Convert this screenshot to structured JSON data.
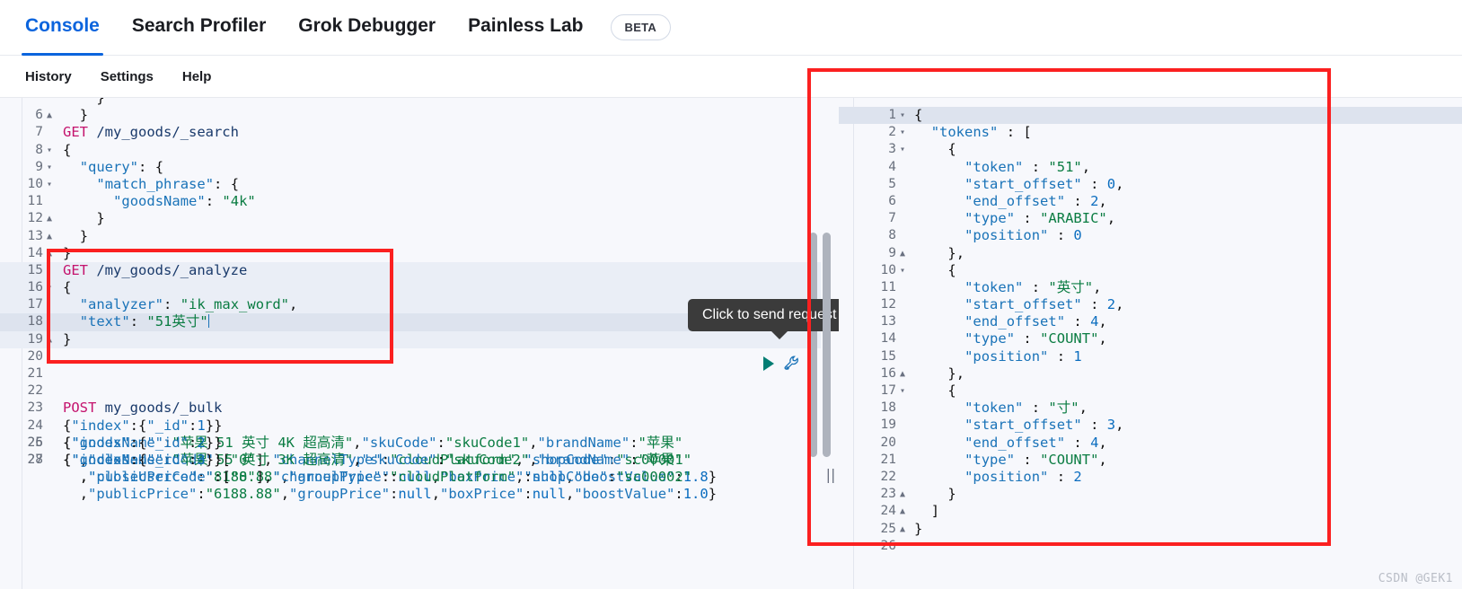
{
  "topnav": {
    "tabs": [
      {
        "label": "Console",
        "active": true
      },
      {
        "label": "Search Profiler",
        "active": false
      },
      {
        "label": "Grok Debugger",
        "active": false
      },
      {
        "label": "Painless Lab",
        "active": false
      }
    ],
    "badge": "BETA"
  },
  "subnav": {
    "items": [
      "History",
      "Settings",
      "Help"
    ]
  },
  "tooltip": {
    "text": "Click to send request"
  },
  "icons": {
    "play": "play-icon",
    "wrench": "wrench-icon",
    "grip": "||"
  },
  "colors": {
    "accent_blue": "#0b64dd",
    "play_teal": "#017d73",
    "wrench_blue": "#1a73b8",
    "annotation_red": "#fb2020",
    "tooltip_bg": "#3b3b3b",
    "editor_bg": "#f7f8fc",
    "method_pink": "#c4136d",
    "string_green": "#0a7c42",
    "key_blue": "#1a73b8"
  },
  "request_editor": {
    "lines": [
      {
        "no": "",
        "fold": "",
        "text": "    }",
        "clipped": true
      },
      {
        "no": "6",
        "fold": "▲",
        "text": "  }"
      },
      {
        "no": "7",
        "fold": "",
        "text": "GET /my_goods/_search",
        "method": "GET",
        "url": " /my_goods/_search"
      },
      {
        "no": "8",
        "fold": "▾",
        "text": "{"
      },
      {
        "no": "9",
        "fold": "▾",
        "text": "  \"query\": {"
      },
      {
        "no": "10",
        "fold": "▾",
        "text": "    \"match_phrase\": {"
      },
      {
        "no": "11",
        "fold": "",
        "text": "      \"goodsName\": \"4k\""
      },
      {
        "no": "12",
        "fold": "▲",
        "text": "    }"
      },
      {
        "no": "13",
        "fold": "▲",
        "text": "  }"
      },
      {
        "no": "14",
        "fold": "▲",
        "text": "}"
      },
      {
        "no": "15",
        "fold": "",
        "text": "GET /my_goods/_analyze",
        "method": "GET",
        "url": " /my_goods/_analyze",
        "selected": true
      },
      {
        "no": "16",
        "fold": "▾",
        "text": "{",
        "selected": true
      },
      {
        "no": "17",
        "fold": "",
        "text": "  \"analyzer\": \"ik_max_word\",",
        "selected": true
      },
      {
        "no": "18",
        "fold": "",
        "text": "  \"text\": \"51英寸\"",
        "selected": true,
        "current": true
      },
      {
        "no": "19",
        "fold": "▲",
        "text": "}",
        "selected": true
      },
      {
        "no": "20",
        "fold": "",
        "text": ""
      },
      {
        "no": "21",
        "fold": "",
        "text": ""
      },
      {
        "no": "22",
        "fold": "",
        "text": ""
      },
      {
        "no": "23",
        "fold": "",
        "text": "POST my_goods/_bulk",
        "method": "POST",
        "url": " my_goods/_bulk"
      },
      {
        "no": "24",
        "fold": "",
        "text": "{\"index\":{\"_id\":1}}"
      },
      {
        "no": "25",
        "fold": "",
        "text": "{\"goodsName\":\"苹果 51 英寸 4K 超高清\",\"skuCode\":\"skuCode1\",\"brandName\":\"苹果\"\n  ,\"closeUserCode\":[\"0\"],\"channelType\":\"cloudPlatform\",\"shopCode\":\"sc00001\"\n  ,\"publicPrice\":\"8188.88\",\"groupPrice\":null,\"boxPrice\":null,\"boostValue\":1.8}"
      },
      {
        "no": "26",
        "fold": "",
        "text": "{\"index\":{\"_id\":2}}"
      },
      {
        "no": "27",
        "fold": "",
        "text": "{\"goodsName\":\"苹果 55 英寸 3K 超高清\",\"skuCode\":\"skuCode2\",\"brandName\":\"苹果\"\n  ,\"closeUserCode\":[\"0\"],\"channelType\":\"cloudPlatform\",\"shopCode\":\"sc00002\"\n  ,\"publicPrice\":\"6188.88\",\"groupPrice\":null,\"boxPrice\":null,\"boostValue\":1.0}"
      },
      {
        "no": "28",
        "fold": "",
        "text": "{\"index\":{\"_id\":3}}"
      }
    ]
  },
  "response_editor": {
    "lines": [
      {
        "no": "1",
        "fold": "▾",
        "text": "{",
        "current": true
      },
      {
        "no": "2",
        "fold": "▾",
        "text": "  \"tokens\" : ["
      },
      {
        "no": "3",
        "fold": "▾",
        "text": "    {"
      },
      {
        "no": "4",
        "fold": "",
        "text": "      \"token\" : \"51\","
      },
      {
        "no": "5",
        "fold": "",
        "text": "      \"start_offset\" : 0,"
      },
      {
        "no": "6",
        "fold": "",
        "text": "      \"end_offset\" : 2,"
      },
      {
        "no": "7",
        "fold": "",
        "text": "      \"type\" : \"ARABIC\","
      },
      {
        "no": "8",
        "fold": "",
        "text": "      \"position\" : 0"
      },
      {
        "no": "9",
        "fold": "▲",
        "text": "    },"
      },
      {
        "no": "10",
        "fold": "▾",
        "text": "    {"
      },
      {
        "no": "11",
        "fold": "",
        "text": "      \"token\" : \"英寸\","
      },
      {
        "no": "12",
        "fold": "",
        "text": "      \"start_offset\" : 2,"
      },
      {
        "no": "13",
        "fold": "",
        "text": "      \"end_offset\" : 4,"
      },
      {
        "no": "14",
        "fold": "",
        "text": "      \"type\" : \"COUNT\","
      },
      {
        "no": "15",
        "fold": "",
        "text": "      \"position\" : 1"
      },
      {
        "no": "16",
        "fold": "▲",
        "text": "    },"
      },
      {
        "no": "17",
        "fold": "▾",
        "text": "    {"
      },
      {
        "no": "18",
        "fold": "",
        "text": "      \"token\" : \"寸\","
      },
      {
        "no": "19",
        "fold": "",
        "text": "      \"start_offset\" : 3,"
      },
      {
        "no": "20",
        "fold": "",
        "text": "      \"end_offset\" : 4,"
      },
      {
        "no": "21",
        "fold": "",
        "text": "      \"type\" : \"COUNT\","
      },
      {
        "no": "22",
        "fold": "",
        "text": "      \"position\" : 2"
      },
      {
        "no": "23",
        "fold": "▲",
        "text": "    }"
      },
      {
        "no": "24",
        "fold": "▲",
        "text": "  ]"
      },
      {
        "no": "25",
        "fold": "▲",
        "text": "}"
      },
      {
        "no": "26",
        "fold": "",
        "text": ""
      }
    ]
  },
  "watermark": {
    "text": "CSDN @GEK1"
  }
}
